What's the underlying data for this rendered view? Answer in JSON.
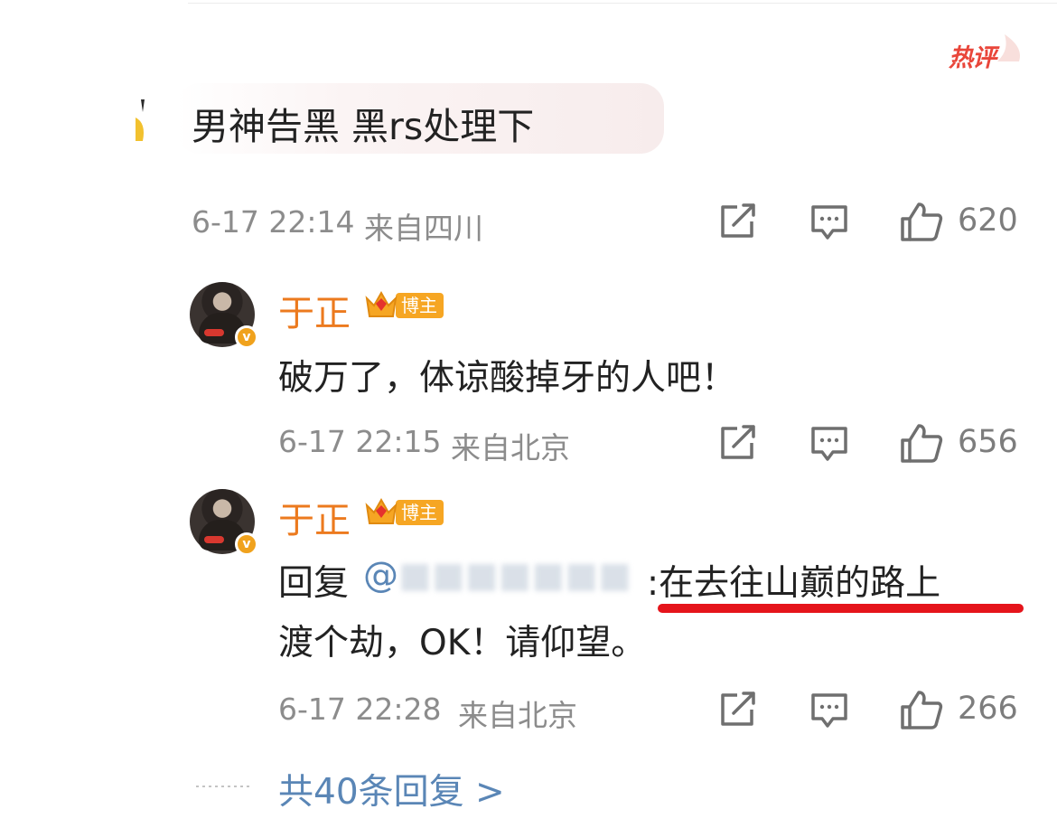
{
  "badge": {
    "hot_label": "热评"
  },
  "top_comment": {
    "text": "男神告黑 黑rs处理下",
    "time": "6-17 22:14",
    "location": "来自四川",
    "likes": "620"
  },
  "replies": [
    {
      "name": "于正",
      "tag": "博主",
      "text": "破万了，体谅酸掉牙的人吧！",
      "time": "6-17 22:15",
      "location": "来自北京",
      "likes": "656"
    },
    {
      "name": "于正",
      "tag": "博主",
      "reply_prefix": "回复",
      "mention_visible": "@",
      "text_line1": ":在去往山巅的路上",
      "text_line2": "渡个劫，OK！请仰望。",
      "time": "6-17 22:28",
      "location": "来自北京",
      "likes": "266"
    }
  ],
  "more_replies": "共40条回复 >",
  "colors": {
    "accent_orange": "#ec7a1e",
    "link_blue": "#5a86b6",
    "hot_red": "#e9463a",
    "underline_red": "#e5141b"
  },
  "icons": [
    "share-icon",
    "comment-icon",
    "thumbs-up-icon",
    "crown-icon",
    "verified-icon"
  ]
}
